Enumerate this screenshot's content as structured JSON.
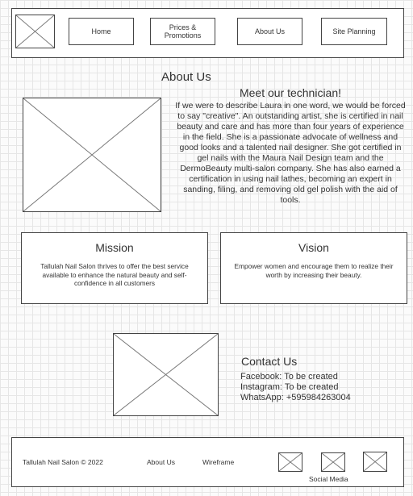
{
  "header": {
    "nav": [
      "Home",
      "Prices &\nPromotions",
      "About Us",
      "Site Planning"
    ]
  },
  "about": {
    "title": "About Us",
    "subtitle": "Meet our technician!",
    "body": "If we were to describe Laura in one word, we would be forced to say \"creative\". An outstanding artist, she is certified in nail beauty and care and has more than four years of experience in the field. She is a passionate advocate of wellness and good looks and a talented nail designer. She got certified in gel nails with the Maura Nail Design team and the DermoBeauty multi-salon company. She has also earned a certification in using nail lathes, becoming an expert in sanding, filing, and removing old gel polish with the aid of tools."
  },
  "mission": {
    "title": "Mission",
    "text": "Tallulah Nail Salon thrives to offer the best service available to enhance the natural beauty and self-confidence in all customers"
  },
  "vision": {
    "title": "Vision",
    "text": "Empower women and encourage them to realize their worth by increasing their beauty."
  },
  "contact": {
    "title": "Contact Us",
    "lines": [
      "Facebook: To be created",
      "Instagram: To be created",
      "WhatsApp: +595984263004"
    ]
  },
  "footer": {
    "copyright": "Tallulah Nail Salon © 2022",
    "links": [
      "About Us",
      "Wireframe"
    ],
    "social_label": "Social Media"
  }
}
